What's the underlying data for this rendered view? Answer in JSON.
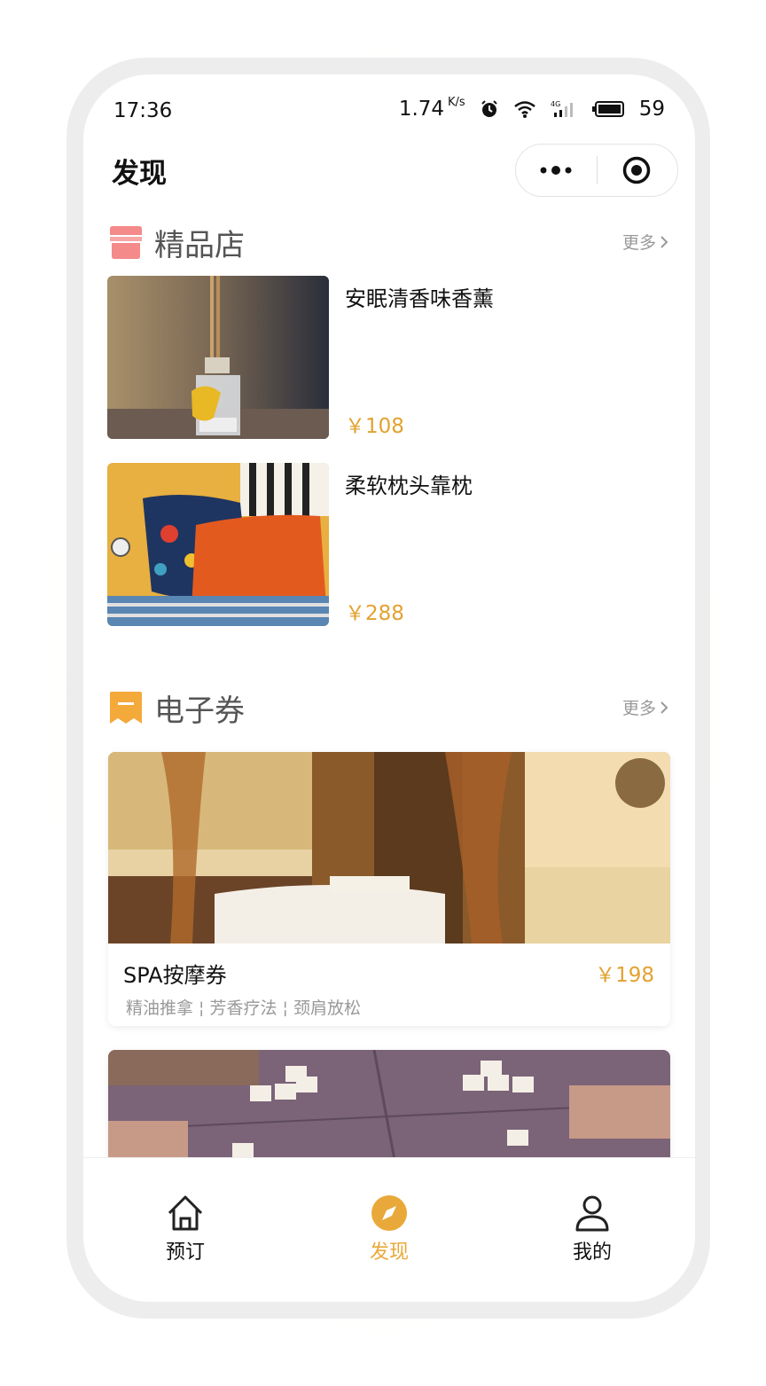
{
  "status_bar": {
    "time": "17:36",
    "speed": "1.74",
    "speed_unit": "K/s",
    "network": "4G",
    "battery": "59"
  },
  "nav": {
    "title": "发现"
  },
  "boutique": {
    "title": "精品店",
    "more": "更多",
    "icon": "store-icon",
    "items": [
      {
        "name": "安眠清香味香薰",
        "price": "￥108"
      },
      {
        "name": "柔软枕头靠枕",
        "price": "￥288"
      }
    ]
  },
  "coupons": {
    "title": "电子券",
    "more": "更多",
    "icon": "coupon-icon",
    "items": [
      {
        "name": "SPA按摩券",
        "price": "￥198",
        "tags": "精油推拿 ¦ 芳香疗法 ¦ 颈肩放松"
      }
    ]
  },
  "tabbar": {
    "items": [
      {
        "label": "预订",
        "icon": "home-icon",
        "active": false
      },
      {
        "label": "发现",
        "icon": "compass-icon",
        "active": true
      },
      {
        "label": "我的",
        "icon": "user-icon",
        "active": false
      }
    ],
    "active_color": "#e9a93a"
  },
  "colors": {
    "accent": "#e2a230",
    "store_icon": "#f58a8a",
    "coupon_icon": "#f4a93b"
  }
}
